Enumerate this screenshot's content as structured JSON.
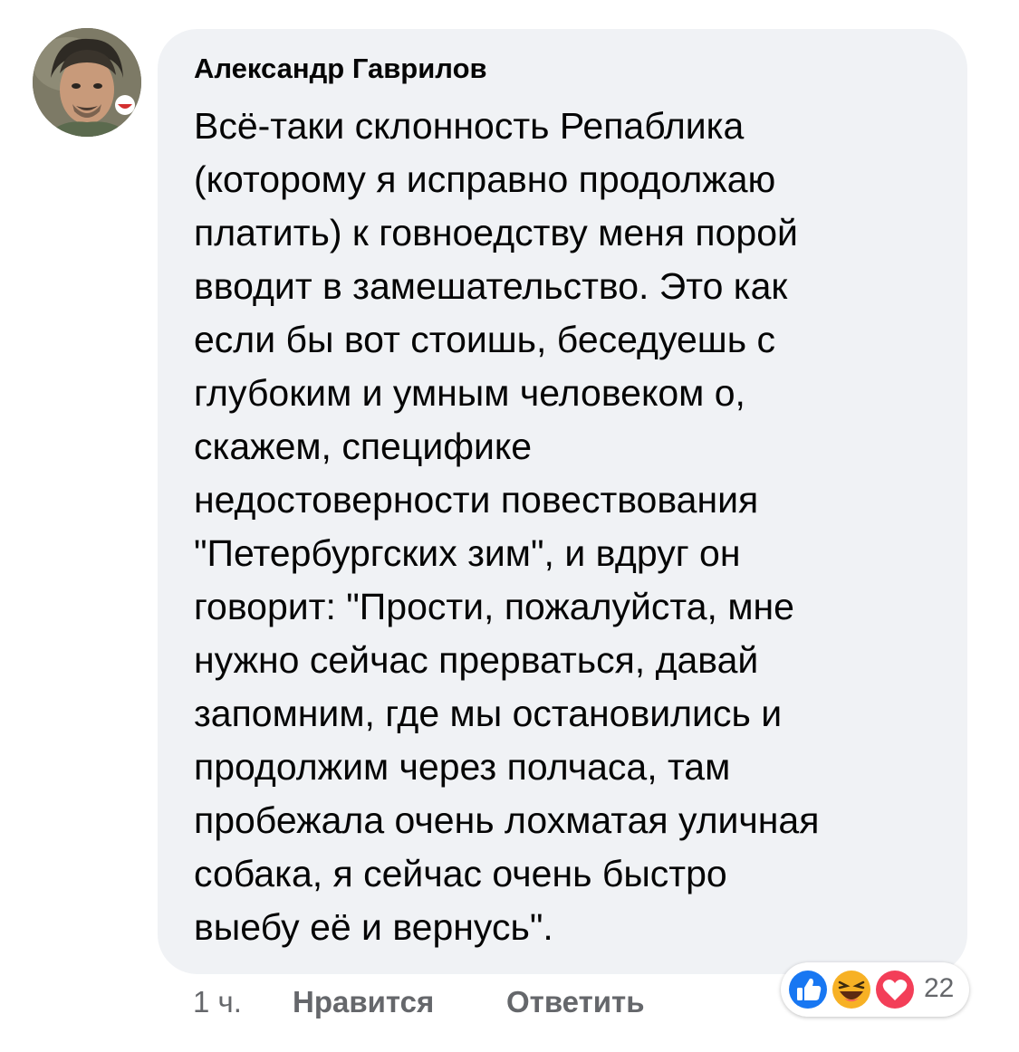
{
  "comment": {
    "author": "Александр Гаврилов",
    "lines": [
      "Всё-таки склонность Репаблика",
      "(которому я исправно продолжаю",
      "платить) к говноедству меня порой",
      "вводит в замешательство. Это как",
      "если бы вот стоишь, беседуешь с",
      "глубоким и умным человеком о,",
      "скажем, специфике",
      "недостоверности повествования",
      "\"Петербургских зим\", и вдруг он",
      "говорит: \"Прости, пожалуйста, мне",
      "нужно сейчас прерваться, давай",
      "запомним, где мы остановились и",
      "продолжим через полчаса, там",
      "пробежала очень лохматая уличная",
      "собака, я сейчас очень быстро",
      "выебу её и вернусь\"."
    ]
  },
  "actions": {
    "time": "1 ч.",
    "like_label": "Нравится",
    "reply_label": "Ответить"
  },
  "reactions": {
    "icons": [
      "like-icon",
      "haha-icon",
      "love-icon"
    ],
    "count": "22"
  },
  "colors": {
    "bubble_bg": "#f0f2f5",
    "like_blue": "#1877f2",
    "love_red": "#f33e58",
    "haha_yellow": "#f7b125",
    "meta_gray": "#65676b"
  }
}
